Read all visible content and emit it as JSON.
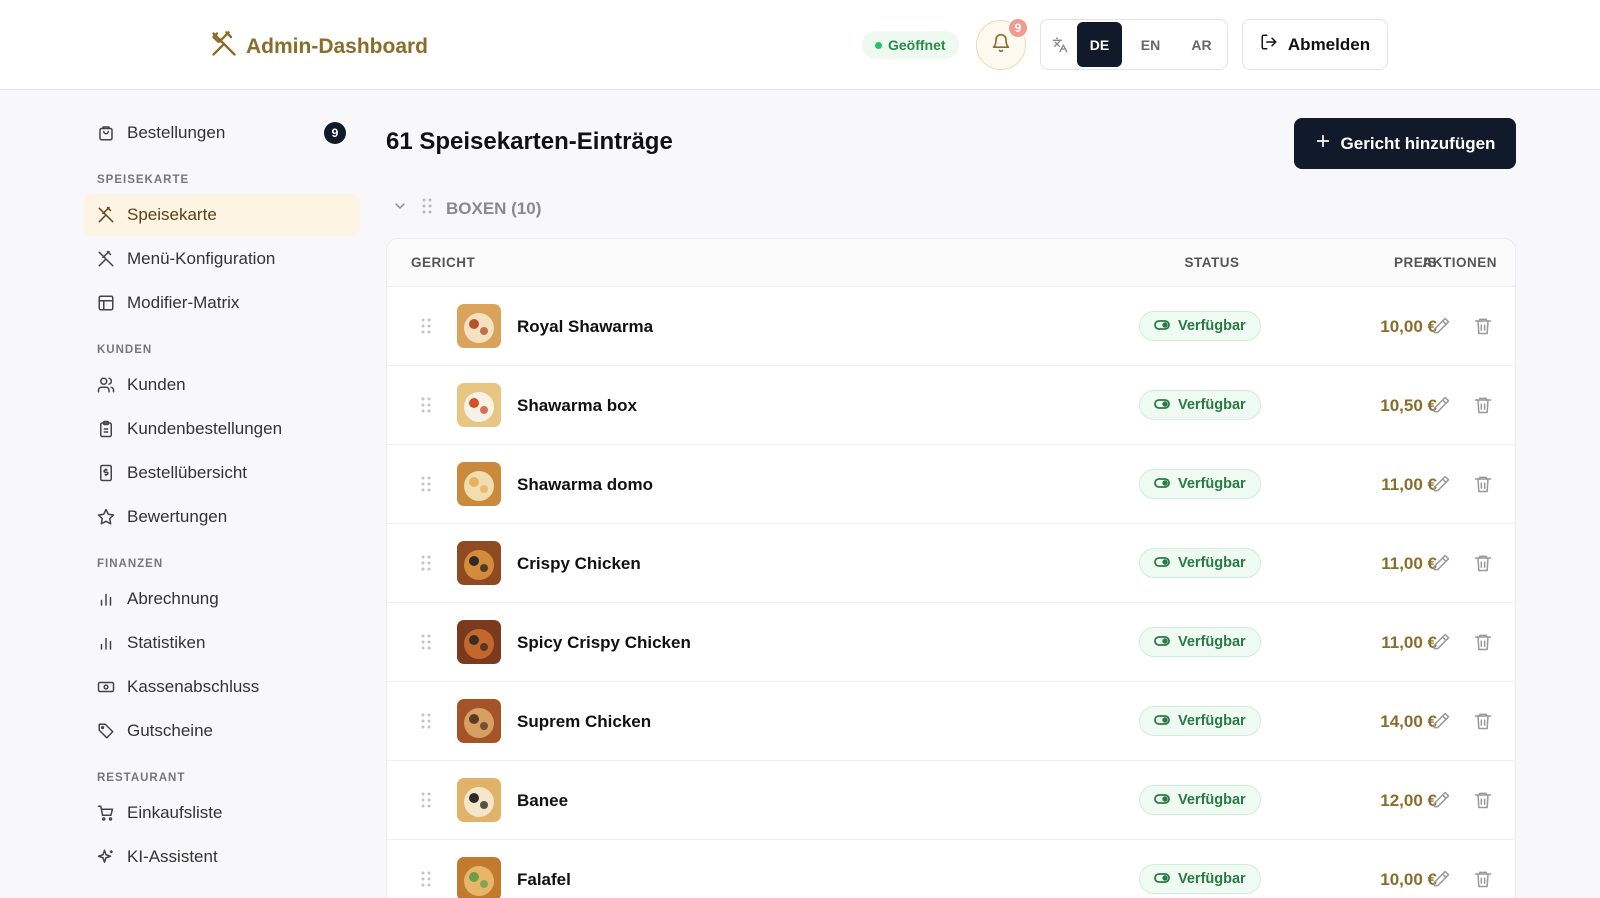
{
  "header": {
    "title": "Admin-Dashboard",
    "status": "Geöffnet",
    "notifications": "9",
    "languages": [
      "DE",
      "EN",
      "AR"
    ],
    "active_language": "DE",
    "logout": "Abmelden",
    "brand_color": "#8a6d2b"
  },
  "sidebar": {
    "orders": {
      "label": "Bestellungen",
      "badge": "9"
    },
    "sections": {
      "menu": "SPEISEKARTE",
      "customers": "KUNDEN",
      "finance": "FINANZEN",
      "restaurant": "RESTAURANT"
    },
    "items": {
      "speisekarte": "Speisekarte",
      "menu_config": "Menü-Konfiguration",
      "modifier": "Modifier-Matrix",
      "kunden": "Kunden",
      "kundenbestellungen": "Kundenbestellungen",
      "bestelluebersicht": "Bestellübersicht",
      "bewertungen": "Bewertungen",
      "abrechnung": "Abrechnung",
      "statistiken": "Statistiken",
      "kassenabschluss": "Kassenabschluss",
      "gutscheine": "Gutscheine",
      "einkaufsliste": "Einkaufsliste",
      "ki_assistent": "KI-Assistent"
    }
  },
  "main": {
    "title": "61 Speisekarten-Einträge",
    "add_button": "Gericht hinzufügen",
    "group": "BOXEN (10)",
    "columns": {
      "name": "GERICHT",
      "price": "PREIS",
      "status": "STATUS",
      "actions": "AKTIONEN"
    },
    "rows": [
      {
        "name": "Royal Shawarma",
        "price": "10,00 €",
        "status": "Verfügbar"
      },
      {
        "name": "Shawarma box",
        "price": "10,50 €",
        "status": "Verfügbar"
      },
      {
        "name": "Shawarma domo",
        "price": "11,00 €",
        "status": "Verfügbar"
      },
      {
        "name": "Crispy Chicken",
        "price": "11,00 €",
        "status": "Verfügbar"
      },
      {
        "name": "Spicy Crispy Chicken",
        "price": "11,00 €",
        "status": "Verfügbar"
      },
      {
        "name": "Suprem Chicken",
        "price": "14,00 €",
        "status": "Verfügbar"
      },
      {
        "name": "Banee",
        "price": "12,00 €",
        "status": "Verfügbar"
      },
      {
        "name": "Falafel",
        "price": "10,00 €",
        "status": "Verfügbar"
      }
    ]
  }
}
